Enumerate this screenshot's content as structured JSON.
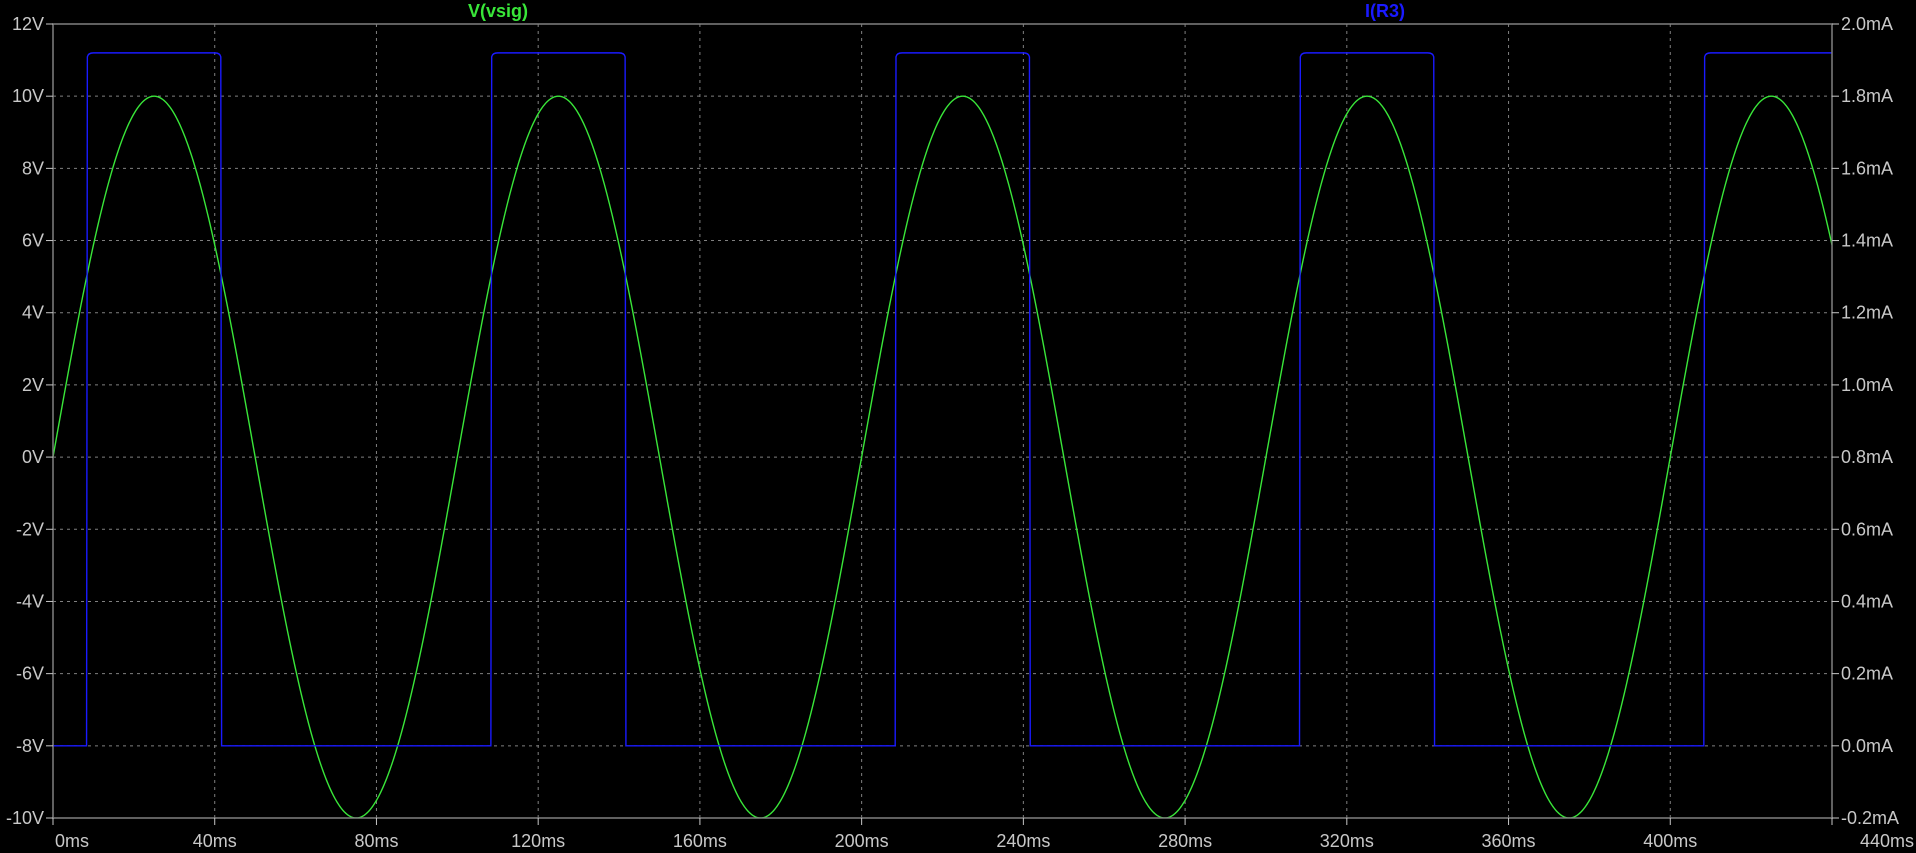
{
  "chart_data": {
    "type": "line",
    "title": "",
    "x_axis": {
      "unit": "ms",
      "range": [
        0,
        440
      ],
      "ticks": [
        0,
        40,
        80,
        120,
        160,
        200,
        240,
        280,
        320,
        360,
        400,
        440
      ],
      "tick_labels": [
        "0ms",
        "40ms",
        "80ms",
        "120ms",
        "160ms",
        "200ms",
        "240ms",
        "280ms",
        "320ms",
        "360ms",
        "400ms",
        "440ms"
      ]
    },
    "y_left": {
      "unit": "V",
      "range": [
        -10,
        12
      ],
      "ticks": [
        -10,
        -8,
        -6,
        -4,
        -2,
        0,
        2,
        4,
        6,
        8,
        10,
        12
      ],
      "tick_labels": [
        "-10V",
        "-8V",
        "-6V",
        "-4V",
        "-2V",
        "0V",
        "2V",
        "4V",
        "6V",
        "8V",
        "10V",
        "12V"
      ]
    },
    "y_right": {
      "unit": "mA",
      "range": [
        -0.2,
        2.0
      ],
      "ticks": [
        -0.2,
        0.0,
        0.2,
        0.4,
        0.6,
        0.8,
        1.0,
        1.2,
        1.4,
        1.6,
        1.8,
        2.0
      ],
      "tick_labels": [
        "-0.2mA",
        "0.0mA",
        "0.2mA",
        "0.4mA",
        "0.6mA",
        "0.8mA",
        "1.0mA",
        "1.2mA",
        "1.4mA",
        "1.6mA",
        "1.8mA",
        "2.0mA"
      ]
    },
    "grid": true,
    "background_color": "#000000",
    "grid_color": "#808080",
    "series": [
      {
        "name": "V(vsig)",
        "color": "#39e639",
        "axis": "left",
        "shape": "sine",
        "amplitude": 10,
        "offset": 0,
        "period_ms": 100,
        "phase_ms": 0
      },
      {
        "name": "I(R3)",
        "color": "#1a1aff",
        "axis": "right",
        "shape": "pulse",
        "low": 0.0,
        "high": 1.92,
        "pulses_ms": [
          [
            8.3,
            41.7
          ],
          [
            108.3,
            141.7
          ],
          [
            208.3,
            241.7
          ],
          [
            308.3,
            341.7
          ],
          [
            408.3,
            441.7
          ]
        ]
      }
    ]
  }
}
